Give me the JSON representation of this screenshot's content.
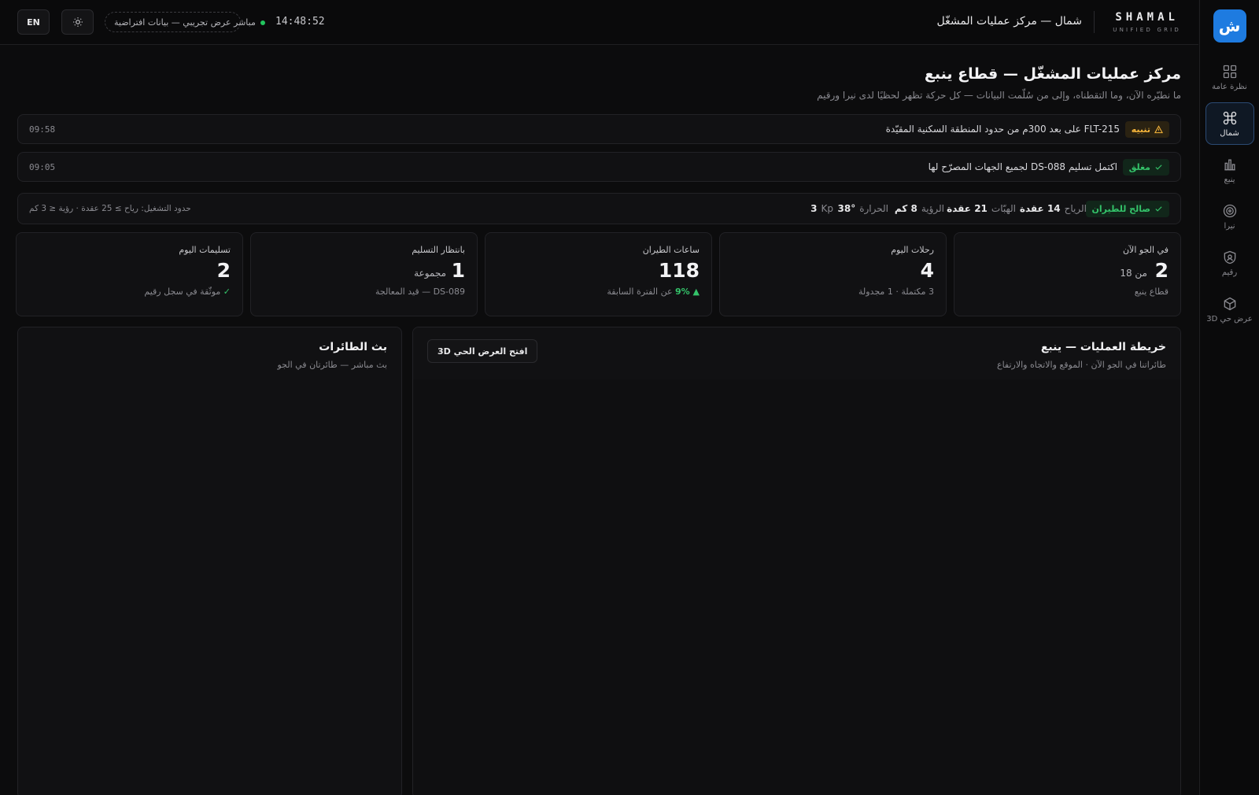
{
  "sidebar": {
    "logo": "ش",
    "items": [
      {
        "label": "نظرة عامة",
        "icon": "grid-icon",
        "active": false
      },
      {
        "label": "شمال",
        "icon": "command-icon",
        "active": true
      },
      {
        "label": "ينبع",
        "icon": "chart-bar-icon",
        "active": false
      },
      {
        "label": "نيرا",
        "icon": "target-icon",
        "active": false
      },
      {
        "label": "رقيم",
        "icon": "shield-icon",
        "active": false
      },
      {
        "label": "عرض حي 3D",
        "icon": "cube-icon",
        "active": false
      }
    ]
  },
  "header": {
    "brand_name": "SHAMAL",
    "brand_sub": "UNIFIED GRID",
    "title": "شمال — مركز عمليات المشغّل",
    "clock": "14:48:52",
    "live_label": "مباشر",
    "demo_label": "عرض تجريبي — بيانات افتراضية",
    "lang_button": "EN",
    "theme_icon": "sun-icon"
  },
  "page": {
    "title": "مركز عمليات المشغّل — قطاع ينبع",
    "subtitle": "ما نطيّره الآن، وما التقطناه، وإلى من سُلّمت البيانات — كل حركة تظهر لحظيًا لدى نيرا ورقيم"
  },
  "alerts": [
    {
      "badge": "تنبيه",
      "badge_icon": "warning-icon",
      "type": "warn",
      "message": "FLT-215 على بعد 300م من حدود المنطقة السكنية المقيّدة",
      "time": "09:58"
    },
    {
      "badge": "مغلق",
      "badge_icon": "check-icon",
      "type": "ok",
      "message": "اكتمل تسليم DS-088 لجميع الجهات المصرّح لها",
      "time": "09:05"
    }
  ],
  "weather": {
    "status": "صالح للطيران",
    "wind_label": "الرياح",
    "wind_value": "14 عقدة",
    "gusts_label": "الهبّات",
    "gusts_value": "21 عقدة",
    "visibility_label": "الرؤية",
    "visibility_value": "8 كم",
    "temp_label": "الحرارة",
    "temp_value": "38°",
    "kp_label": "Kp",
    "kp_value": "3",
    "limits": "حدود التشغيل: رياح ≥ 25 عقدة · رؤية ≤ 3 كم"
  },
  "stats": [
    {
      "label": "في الجو الآن",
      "value": "2",
      "unit": "من 18",
      "foot": "قطاع ينبع"
    },
    {
      "label": "رحلات اليوم",
      "value": "4",
      "unit": "",
      "foot": "3 مكتملة · 1 مجدولة"
    },
    {
      "label": "ساعات الطيران",
      "value": "118",
      "unit": "",
      "foot_up": "▲ 9%",
      "foot": "عن الفترة السابقة"
    },
    {
      "label": "بانتظار التسليم",
      "value": "1",
      "unit": "مجموعة",
      "foot": "DS-089 — قيد المعالجة"
    },
    {
      "label": "تسليمات اليوم",
      "value": "2",
      "unit": "",
      "foot_check": "✓",
      "foot": "موثّقة في سجل رقيم"
    }
  ],
  "map": {
    "title": "خريطة العمليات — ينبع",
    "subtitle": "طائراتنا في الجو الآن · الموقع والاتجاه والارتفاع",
    "button": "افتح العرض الحي 3D"
  },
  "feed": {
    "title": "بث الطائرات",
    "subtitle": "بث مباشر — طائرتان في الجو"
  },
  "colors": {
    "accent": "#1e7be0",
    "warn": "#f5b43a",
    "ok": "#34c36a",
    "background": "#0c0c0d"
  }
}
